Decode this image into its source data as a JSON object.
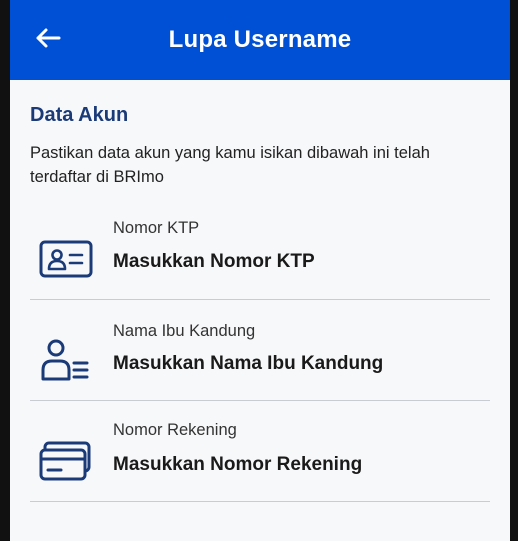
{
  "header": {
    "title": "Lupa Username"
  },
  "section": {
    "title": "Data Akun",
    "description": "Pastikan data akun yang kamu isikan dibawah ini telah terdaftar di BRImo"
  },
  "fields": [
    {
      "label": "Nomor KTP",
      "placeholder": "Masukkan Nomor KTP",
      "icon": "id-card-icon"
    },
    {
      "label": "Nama Ibu Kandung",
      "placeholder": "Masukkan Nama Ibu Kandung",
      "icon": "person-list-icon"
    },
    {
      "label": "Nomor Rekening",
      "placeholder": "Masukkan Nomor Rekening",
      "icon": "bank-card-icon"
    }
  ],
  "colors": {
    "header_bg": "#0050d6",
    "icon_blue": "#1b3b78"
  }
}
